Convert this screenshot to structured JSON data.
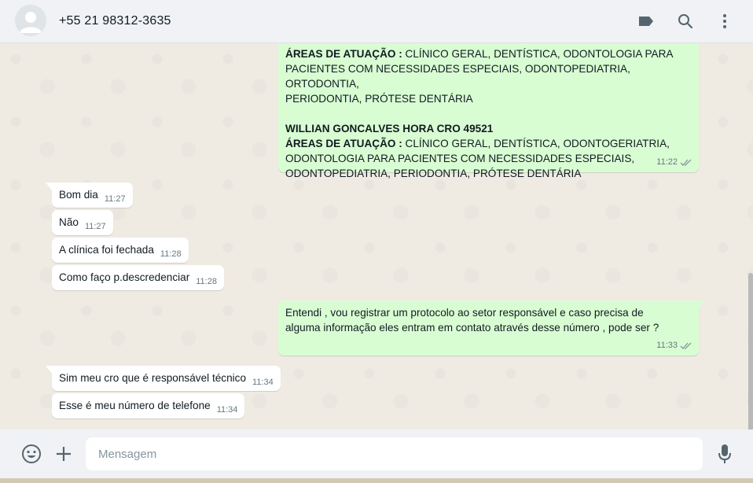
{
  "header": {
    "contact_name": "+55 21 98312-3635",
    "icons": [
      "label-icon",
      "search-icon",
      "menu-icon"
    ]
  },
  "messages": {
    "m1": {
      "direction": "outgoing",
      "line1_bold": "ÁREAS DE ATUAÇÃO :",
      "line1_rest": " CLÍNICO GERAL, DENTÍSTICA, ODONTOLOGIA PARA",
      "line2": "PACIENTES COM NECESSIDADES ESPECIAIS, ODONTOPEDIATRIA, ORTODONTIA,",
      "line3": "PERIODONTIA, PRÓTESE DENTÁRIA",
      "name": "WILLIAN GONCALVES HORA  CRO 49521",
      "line4_bold": "ÁREAS DE ATUAÇÃO :",
      "line4_rest": " CLÍNICO GERAL, DENTÍSTICA, ODONTOGERIATRIA,",
      "line5": "ODONTOLOGIA PARA PACIENTES COM NECESSIDADES ESPECIAIS,",
      "line6": "ODONTOPEDIATRIA, PERIODONTIA, PRÓTESE DENTÁRIA",
      "time": "11:22",
      "status": "double-check"
    },
    "m2": {
      "direction": "incoming",
      "text": "Bom dia",
      "time": "11:27"
    },
    "m3": {
      "direction": "incoming",
      "text": "Não",
      "time": "11:27"
    },
    "m4": {
      "direction": "incoming",
      "text": "A clínica foi fechada",
      "time": "11:28"
    },
    "m5": {
      "direction": "incoming",
      "text": "Como faço p.descredenciar",
      "time": "11:28"
    },
    "m6": {
      "direction": "outgoing",
      "line1": "Entendi , vou registrar um protocolo ao  setor responsável e caso precisa de",
      "line2": "alguma informação eles entram em contato através desse número , pode ser ?",
      "time": "11:33",
      "status": "double-check"
    },
    "m7": {
      "direction": "incoming",
      "text": "Sim meu cro que é responsável técnico",
      "time": "11:34"
    },
    "m8": {
      "direction": "incoming",
      "text": "Esse é meu número de telefone",
      "time": "11:34"
    }
  },
  "composer": {
    "placeholder": "Mensagem",
    "icons": [
      "emoji-icon",
      "plus-icon",
      "microphone-icon"
    ]
  },
  "colors": {
    "outgoing_bubble": "#d9fdd3",
    "incoming_bubble": "#ffffff",
    "chat_background": "#efeae2",
    "header_background": "#f0f2f5",
    "read_ticks": "#8696a0"
  }
}
